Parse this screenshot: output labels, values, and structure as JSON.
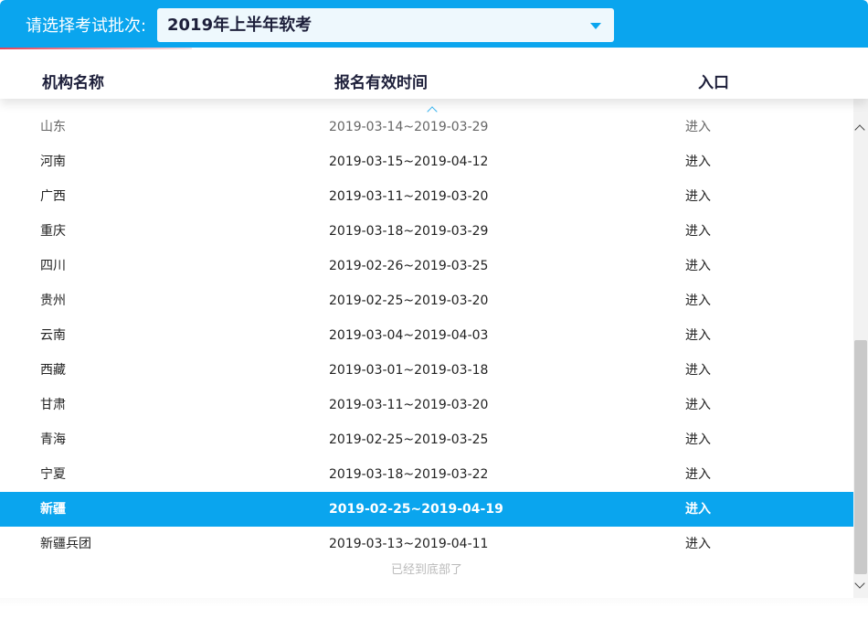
{
  "batch": {
    "label": "请选择考试批次:",
    "selected": "2019年上半年软考"
  },
  "table": {
    "headers": {
      "name": "机构名称",
      "time": "报名有效时间",
      "entry": "入口"
    },
    "rows": [
      {
        "name": "山东",
        "time": "2019-03-14~2019-03-29",
        "entry": "进入"
      },
      {
        "name": "河南",
        "time": "2019-03-15~2019-04-12",
        "entry": "进入"
      },
      {
        "name": "广西",
        "time": "2019-03-11~2019-03-20",
        "entry": "进入"
      },
      {
        "name": "重庆",
        "time": "2019-03-18~2019-03-29",
        "entry": "进入"
      },
      {
        "name": "四川",
        "time": "2019-02-26~2019-03-25",
        "entry": "进入"
      },
      {
        "name": "贵州",
        "time": "2019-02-25~2019-03-20",
        "entry": "进入"
      },
      {
        "name": "云南",
        "time": "2019-03-04~2019-04-03",
        "entry": "进入"
      },
      {
        "name": "西藏",
        "time": "2019-03-01~2019-03-18",
        "entry": "进入"
      },
      {
        "name": "甘肃",
        "time": "2019-03-11~2019-03-20",
        "entry": "进入"
      },
      {
        "name": "青海",
        "time": "2019-02-25~2019-03-25",
        "entry": "进入"
      },
      {
        "name": "宁夏",
        "time": "2019-03-18~2019-03-22",
        "entry": "进入"
      },
      {
        "name": "新疆",
        "time": "2019-02-25~2019-04-19",
        "entry": "进入"
      },
      {
        "name": "新疆兵团",
        "time": "2019-03-13~2019-04-11",
        "entry": "进入"
      }
    ],
    "selected_row": "新疆",
    "end_note": "已经到底部了"
  },
  "colors": {
    "accent": "#0aa5ee",
    "header_text": "#1d1f3a",
    "underline": "#e8445a"
  },
  "icons": {
    "dropdown": "caret-down-icon",
    "sort": "chevron-up-icon",
    "scroll_up": "chevron-up-icon",
    "scroll_down": "chevron-down-icon"
  }
}
